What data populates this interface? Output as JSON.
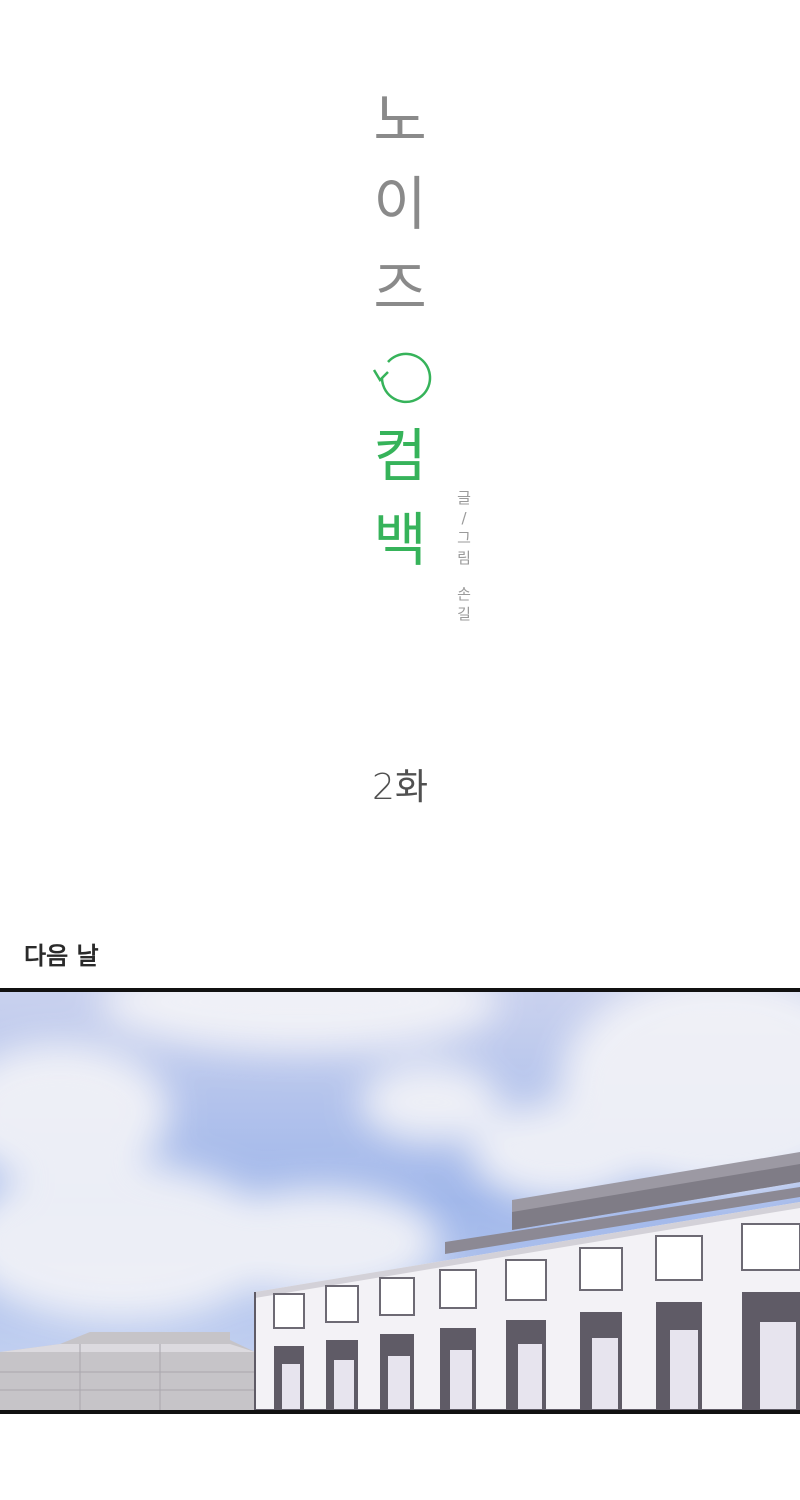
{
  "title": {
    "chars_gray": [
      "노",
      "이",
      "즈"
    ],
    "chars_green": [
      "컴",
      "백"
    ],
    "loop_icon": "loop-arrow-icon",
    "gray_color": "#8a8a8a",
    "green_color": "#36b35a"
  },
  "credit": {
    "line1": [
      "글",
      "/",
      "그",
      "림"
    ],
    "line2": [
      "손",
      "길"
    ]
  },
  "episode": "2화",
  "caption": "다음 날",
  "panel": {
    "scene": "sky-and-school-building-illustration"
  }
}
